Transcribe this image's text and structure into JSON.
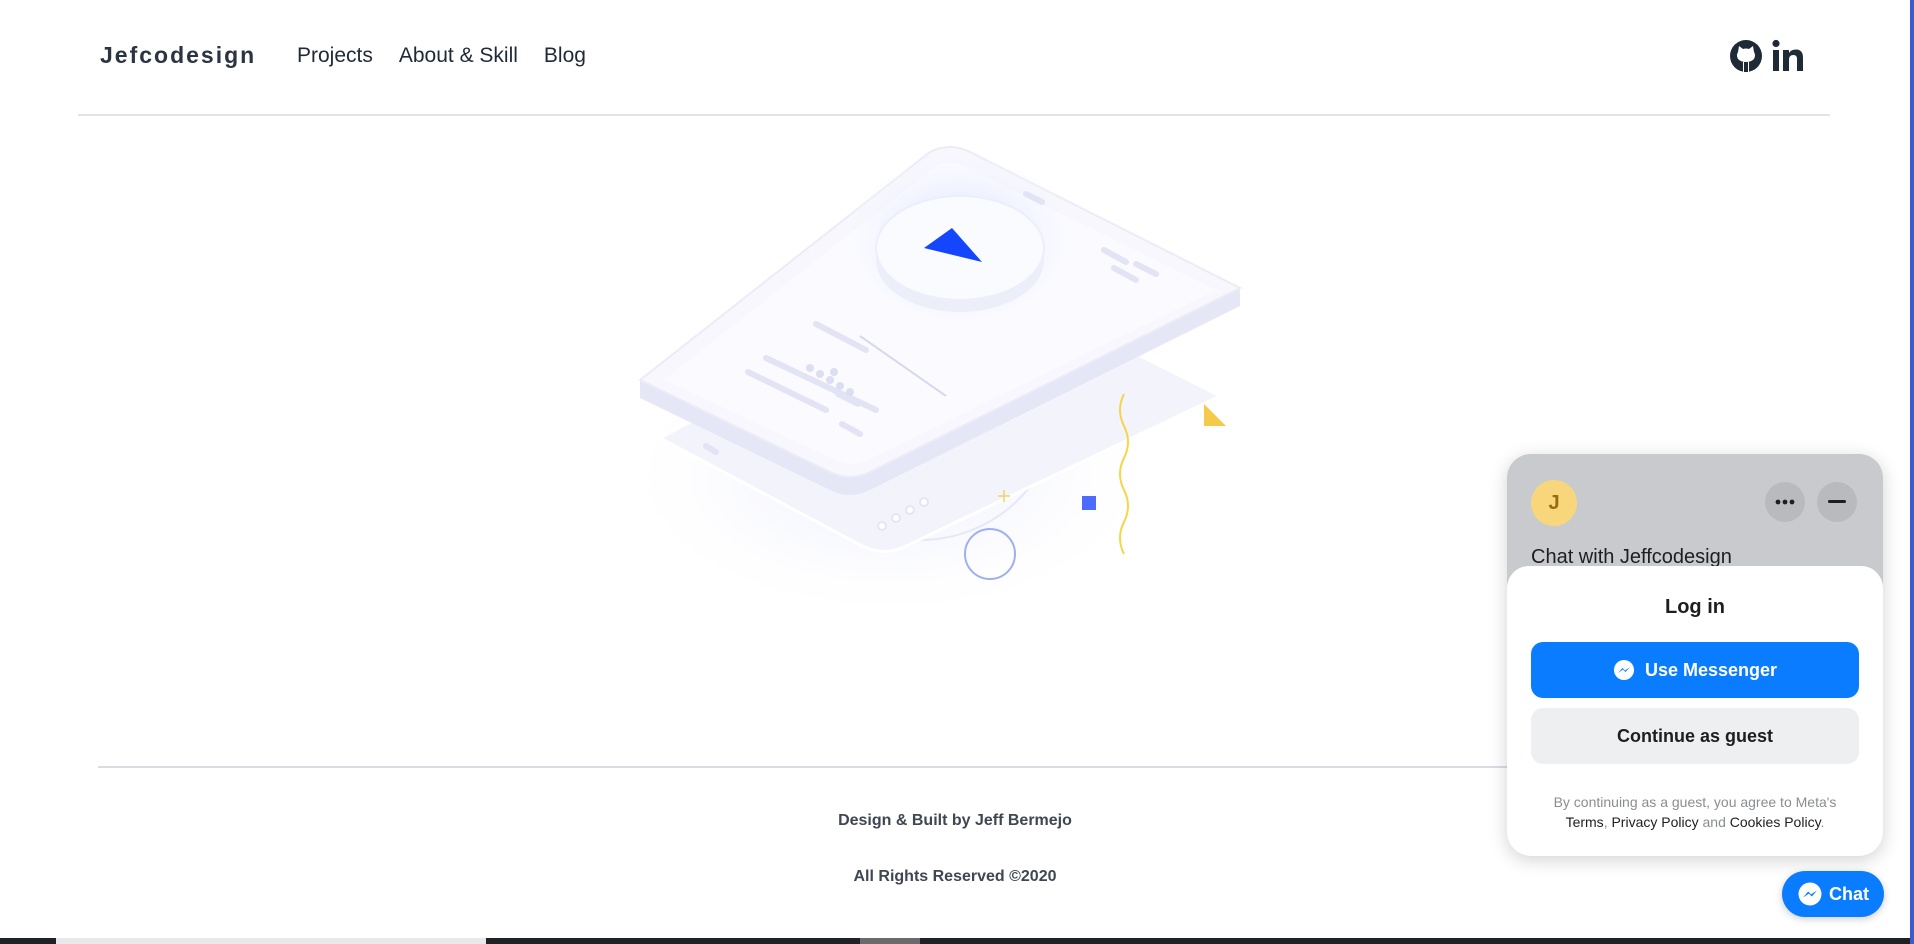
{
  "header": {
    "brand": "Jefcodesign",
    "nav": [
      "Projects",
      "About & Skill",
      "Blog"
    ],
    "social_icons": [
      "github-icon",
      "linkedin-icon"
    ]
  },
  "footer": {
    "credit": "Design & Built by Jeff Bermejo",
    "rights": "All Rights Reserved ©2020"
  },
  "chat_panel": {
    "avatar_letter": "J",
    "title": "Chat with Jeffcodesign",
    "login_title": "Log in",
    "messenger_button": "Use Messenger",
    "guest_button": "Continue as guest",
    "consent_prefix": "By continuing as a guest, you agree to Meta's",
    "terms": "Terms",
    "comma": ",",
    "privacy": "Privacy Policy",
    "and": "and",
    "cookies": "Cookies Policy",
    "period": "."
  },
  "chat_button": {
    "label": "Chat"
  },
  "colors": {
    "messenger_blue": "#0a7cff",
    "play_blue": "#1546ff",
    "accent_yellow": "#f5c94a",
    "avatar_yellow": "#f8d77c"
  }
}
